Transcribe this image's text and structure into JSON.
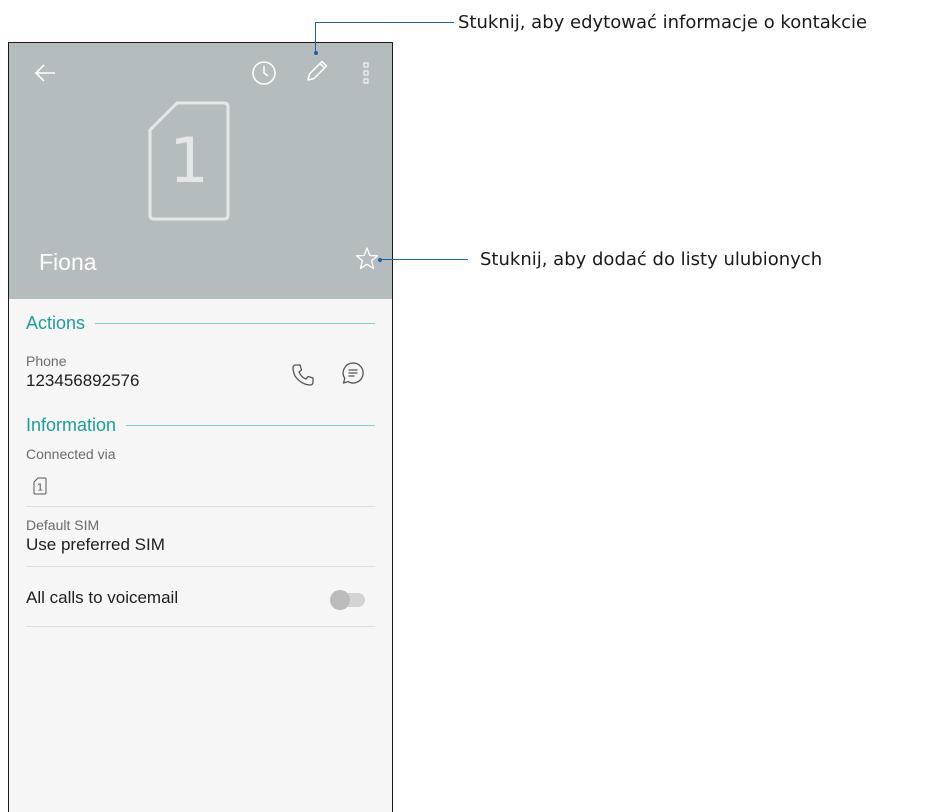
{
  "header": {
    "contact_name": "Fiona",
    "sim_number": "1",
    "icons": [
      "back-arrow-icon",
      "history-icon",
      "edit-pencil-icon",
      "more-options-icon",
      "sim-card-icon",
      "star-outline-icon"
    ]
  },
  "actions": {
    "section_title": "Actions",
    "phone_caption": "Phone",
    "phone_number": "123456892576",
    "icons": [
      "phone-call-icon",
      "message-icon"
    ]
  },
  "information": {
    "section_title": "Information",
    "connected_via_caption": "Connected via",
    "connected_sim": "1",
    "default_sim_caption": "Default SIM",
    "default_sim_value": "Use preferred SIM",
    "voicemail_label": "All calls to voicemail",
    "voicemail_enabled": false
  },
  "callouts": {
    "edit": "Stuknij, aby edytować informacje o kontakcie",
    "favorite": "Stuknij, aby dodać do listy ulubionych"
  },
  "colors": {
    "header_bg": "#b5bcc0",
    "accent": "#1a9e9a",
    "callout_line": "#1a63a8",
    "screen_bg": "#f6f6f6"
  }
}
